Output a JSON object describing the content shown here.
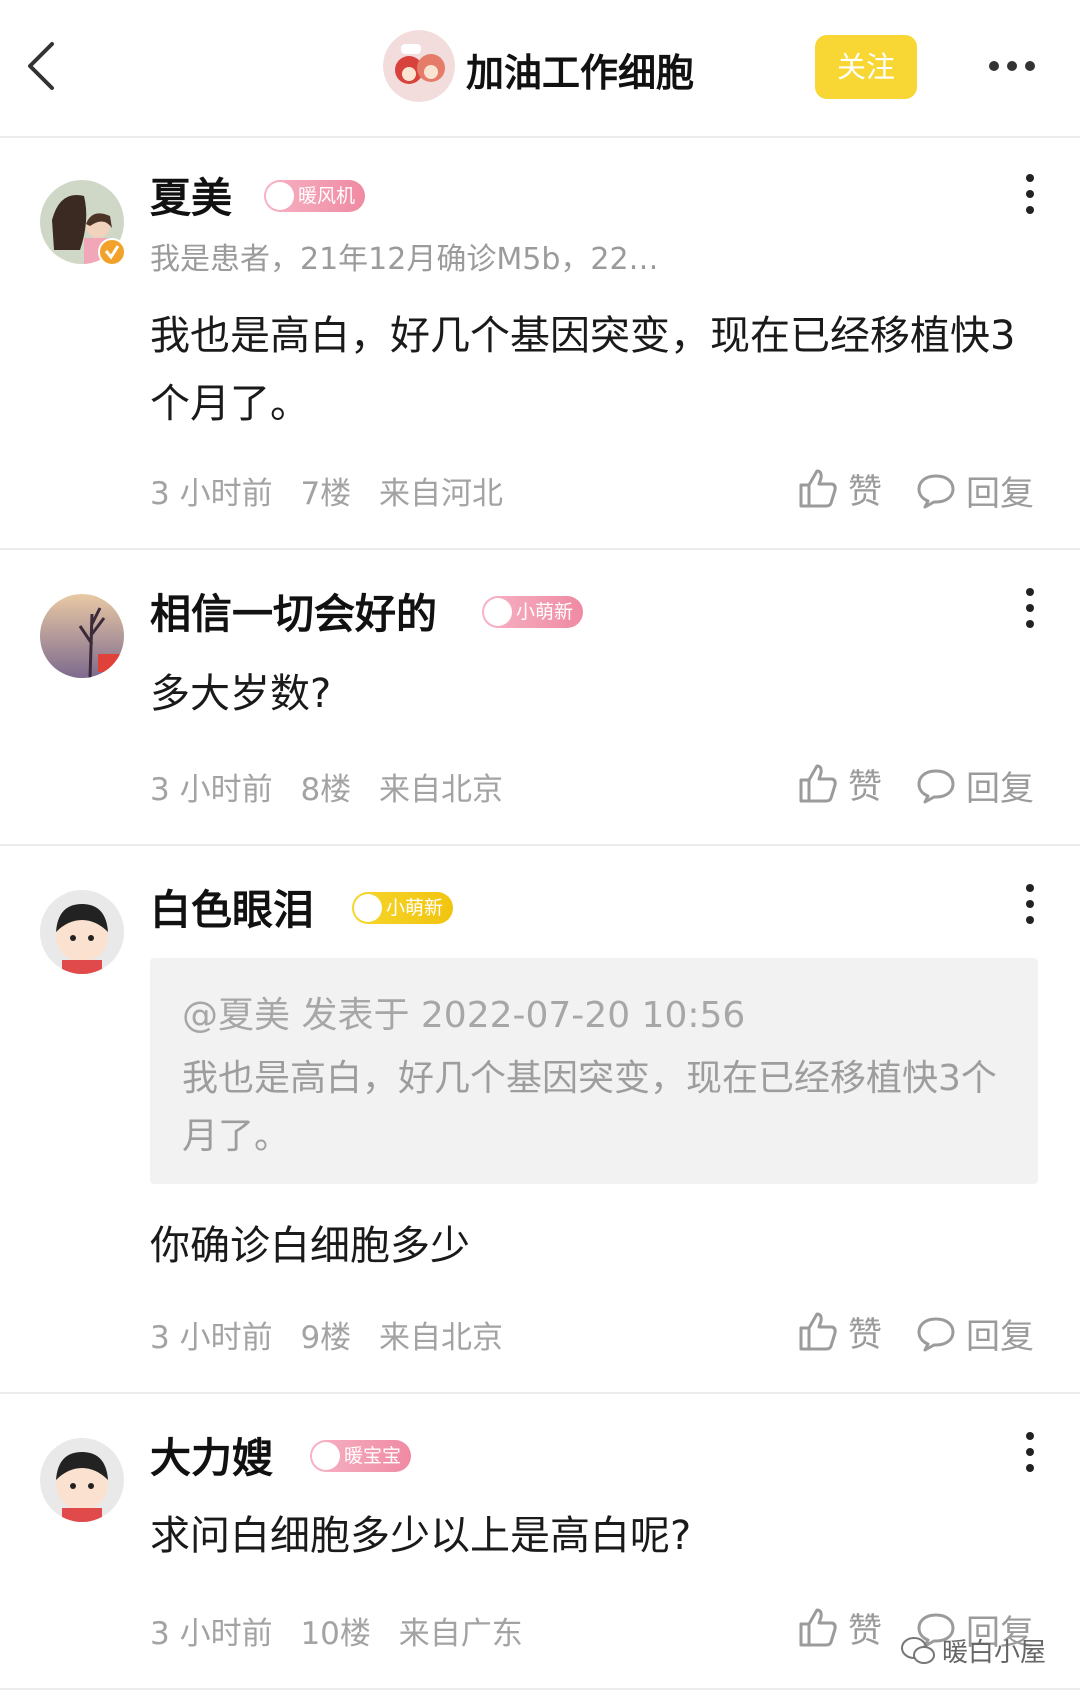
{
  "header": {
    "title": "加油工作细胞",
    "follow_label": "关注"
  },
  "comments": [
    {
      "username": "夏美",
      "badge": "暖风机",
      "subtitle": "我是患者，21年12月确诊M5b，22…",
      "text": "我也是高白，好几个基因突变，现在已经移植快3个月了。",
      "time": "3 小时前",
      "floor": "7楼",
      "location": "来自河北",
      "like_label": "赞",
      "reply_label": "回复"
    },
    {
      "username": "相信一切会好的",
      "badge": "小萌新",
      "text": "多大岁数?",
      "time": "3 小时前",
      "floor": "8楼",
      "location": "来自北京",
      "like_label": "赞",
      "reply_label": "回复"
    },
    {
      "username": "白色眼泪",
      "badge": "小萌新",
      "quote": {
        "header": "@夏美 发表于 2022-07-20 10:56",
        "text": "我也是高白，好几个基因突变，现在已经移植快3个月了。"
      },
      "text": "你确诊白细胞多少",
      "time": "3 小时前",
      "floor": "9楼",
      "location": "来自北京",
      "like_label": "赞",
      "reply_label": "回复"
    },
    {
      "username": "大力嫂",
      "badge": "暖宝宝",
      "text": "求问白细胞多少以上是高白呢?",
      "time": "3 小时前",
      "floor": "10楼",
      "location": "来自广东",
      "like_label": "赞",
      "reply_label": "回复"
    }
  ],
  "watermark": "暖白小屋",
  "colors": {
    "accent_yellow": "#f8d633",
    "badge_pink": "#ef8aa3",
    "text_gray": "#9b9b9b"
  }
}
